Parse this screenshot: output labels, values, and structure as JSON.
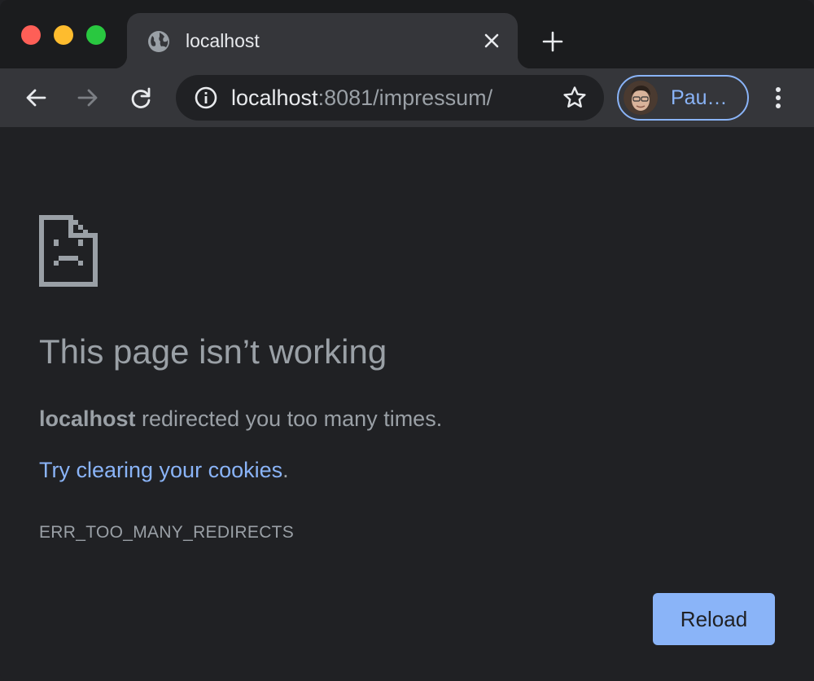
{
  "window": {
    "traffic_lights": {
      "close": "#fe5f57",
      "minimize": "#febc2e",
      "zoom": "#29c840"
    }
  },
  "tab": {
    "title": "localhost",
    "favicon": "globe-icon",
    "close_icon": "close-icon"
  },
  "toolbar": {
    "back_icon": "arrow-left-icon",
    "forward_icon": "arrow-right-icon",
    "reload_icon": "reload-icon",
    "omnibox": {
      "host": "localhost",
      "rest": ":8081/impressum/",
      "info_icon": "info-icon",
      "bookmark_icon": "star-icon"
    },
    "profile": {
      "name": "Pau…"
    },
    "menu_icon": "kebab-menu-icon"
  },
  "error_page": {
    "icon": "sad-page-icon",
    "heading": "This page isn’t working",
    "host": "localhost",
    "message": " redirected you too many times.",
    "suggestion_link": "Try clearing your cookies",
    "suggestion_suffix": ".",
    "error_code": "ERR_TOO_MANY_REDIRECTS",
    "reload_label": "Reload"
  },
  "colors": {
    "background": "#202124",
    "toolbar": "#35363a",
    "link": "#8ab4f8",
    "text_secondary": "#9aa0a6"
  }
}
